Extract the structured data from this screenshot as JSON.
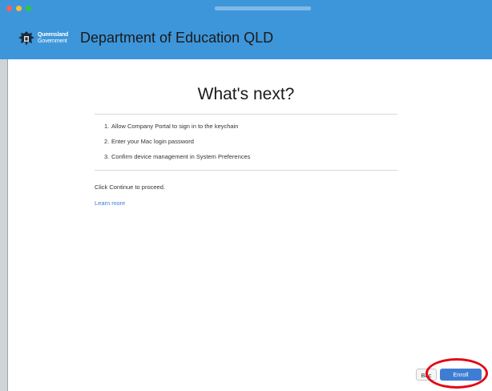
{
  "window": {
    "header_color": "#3e96da",
    "traffic_lights": [
      "close",
      "minimize",
      "maximize"
    ]
  },
  "header": {
    "logo_icon": "queensland-crest-icon",
    "gov_line1": "Queensland",
    "gov_line2": "Government",
    "title": "Department of Education QLD"
  },
  "main": {
    "heading": "What's next?",
    "steps": [
      {
        "num": "1.",
        "text": "Allow Company Portal to sign in to the keychain"
      },
      {
        "num": "2.",
        "text": "Enter your Mac login password"
      },
      {
        "num": "3.",
        "text": "Confirm device management in System Preferences"
      }
    ],
    "proceed_text": "Click Continue to proceed.",
    "learn_more": "Learn more"
  },
  "footer": {
    "back_label": "Bac",
    "enroll_label": "Enroll",
    "accent_color": "#3d7ed4",
    "annotation_color": "#e30613"
  }
}
